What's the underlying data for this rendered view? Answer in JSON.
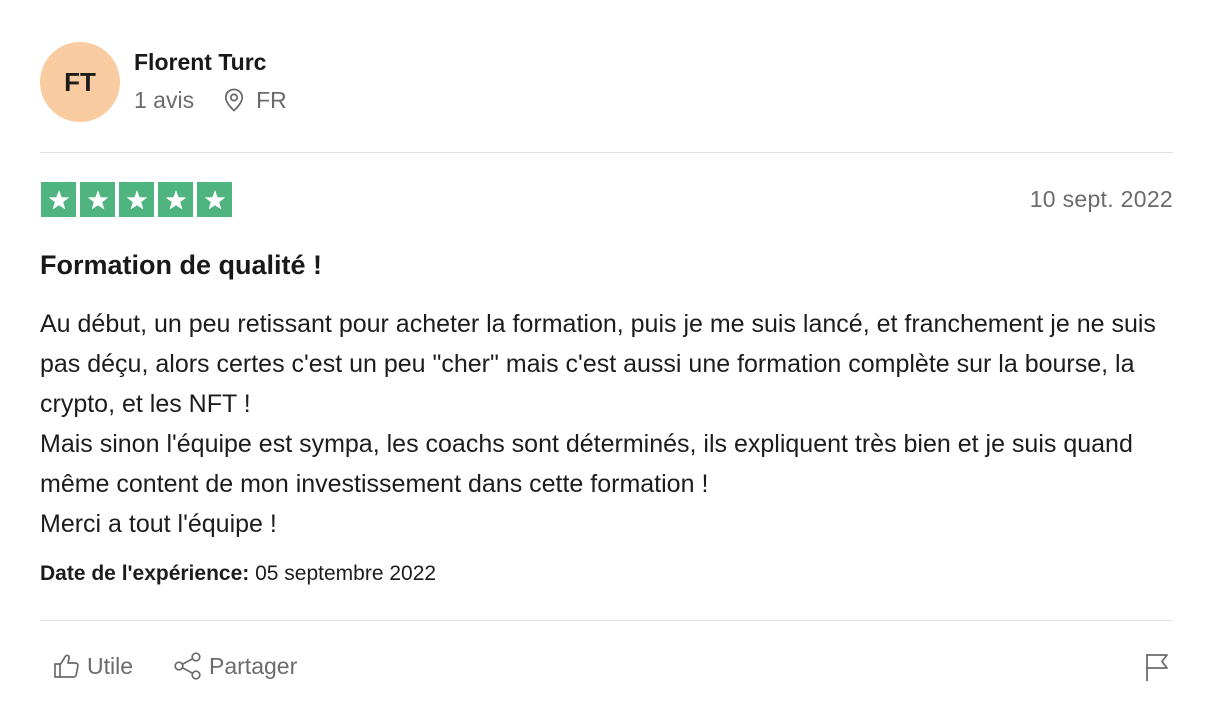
{
  "user": {
    "initials": "FT",
    "name": "Florent Turc",
    "reviews_count": "1 avis",
    "country": "FR",
    "avatar_color": "#f8cba0"
  },
  "review": {
    "rating": 5,
    "rating_max": 5,
    "star_color": "#4fb47f",
    "date": "10 sept. 2022",
    "title": "Formation de qualité !",
    "body_lines": [
      "Au début, un peu retissant pour acheter la formation, puis je me suis lancé, et franchement je ne suis pas déçu, alors certes c'est un peu \"cher\" mais c'est aussi une formation complète sur la bourse, la crypto, et les NFT !",
      "Mais sinon l'équipe est sympa, les coachs sont déterminés, ils expliquent très bien et je suis quand même content de mon investissement dans cette formation !",
      "Merci a tout l'équipe !"
    ],
    "experience_label": "Date de l'expérience:",
    "experience_date": "05 septembre 2022"
  },
  "actions": {
    "useful_label": "Utile",
    "useful_icon": "thumbs-up-icon",
    "share_label": "Partager",
    "share_icon": "share-icon",
    "report_icon": "flag-icon"
  }
}
